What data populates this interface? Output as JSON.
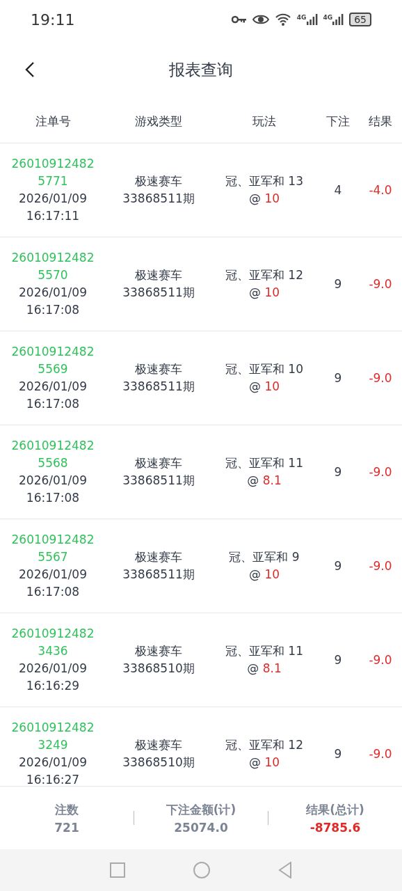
{
  "status_bar": {
    "time": "19:11",
    "networks": [
      "4G",
      "4G"
    ],
    "battery": "65"
  },
  "header": {
    "title": "报表查询"
  },
  "table": {
    "columns": [
      "注单号",
      "游戏类型",
      "玩法",
      "下注",
      "结果"
    ],
    "rows": [
      {
        "order_no": "260109124825771",
        "date": "2026/01/09",
        "time": "16:17:11",
        "game": "极速赛车",
        "period": "33868511期",
        "bet": "冠、亚军和 13",
        "at": "@",
        "odds": "10",
        "stake": "4",
        "result": "-4.0"
      },
      {
        "order_no": "260109124825570",
        "date": "2026/01/09",
        "time": "16:17:08",
        "game": "极速赛车",
        "period": "33868511期",
        "bet": "冠、亚军和 12",
        "at": "@",
        "odds": "10",
        "stake": "9",
        "result": "-9.0"
      },
      {
        "order_no": "260109124825569",
        "date": "2026/01/09",
        "time": "16:17:08",
        "game": "极速赛车",
        "period": "33868511期",
        "bet": "冠、亚军和 10",
        "at": "@",
        "odds": "10",
        "stake": "9",
        "result": "-9.0"
      },
      {
        "order_no": "260109124825568",
        "date": "2026/01/09",
        "time": "16:17:08",
        "game": "极速赛车",
        "period": "33868511期",
        "bet": "冠、亚军和 11",
        "at": "@",
        "odds": "8.1",
        "stake": "9",
        "result": "-9.0"
      },
      {
        "order_no": "260109124825567",
        "date": "2026/01/09",
        "time": "16:17:08",
        "game": "极速赛车",
        "period": "33868511期",
        "bet": "冠、亚军和 9",
        "at": "@",
        "odds": "10",
        "stake": "9",
        "result": "-9.0"
      },
      {
        "order_no": "260109124823436",
        "date": "2026/01/09",
        "time": "16:16:29",
        "game": "极速赛车",
        "period": "33868510期",
        "bet": "冠、亚军和 11",
        "at": "@",
        "odds": "8.1",
        "stake": "9",
        "result": "-9.0"
      },
      {
        "order_no": "260109124823249",
        "date": "2026/01/09",
        "time": "16:16:27",
        "game": "极速赛车",
        "period": "33868510期",
        "bet": "冠、亚军和 12",
        "at": "@",
        "odds": "10",
        "stake": "9",
        "result": "-9.0"
      }
    ]
  },
  "summary": [
    {
      "label": "注数",
      "value": "721",
      "kind": "plain"
    },
    {
      "label": "下注金额(计)",
      "value": "25074.0",
      "kind": "plain"
    },
    {
      "label": "结果(总计)",
      "value": "-8785.6",
      "kind": "loss"
    }
  ]
}
